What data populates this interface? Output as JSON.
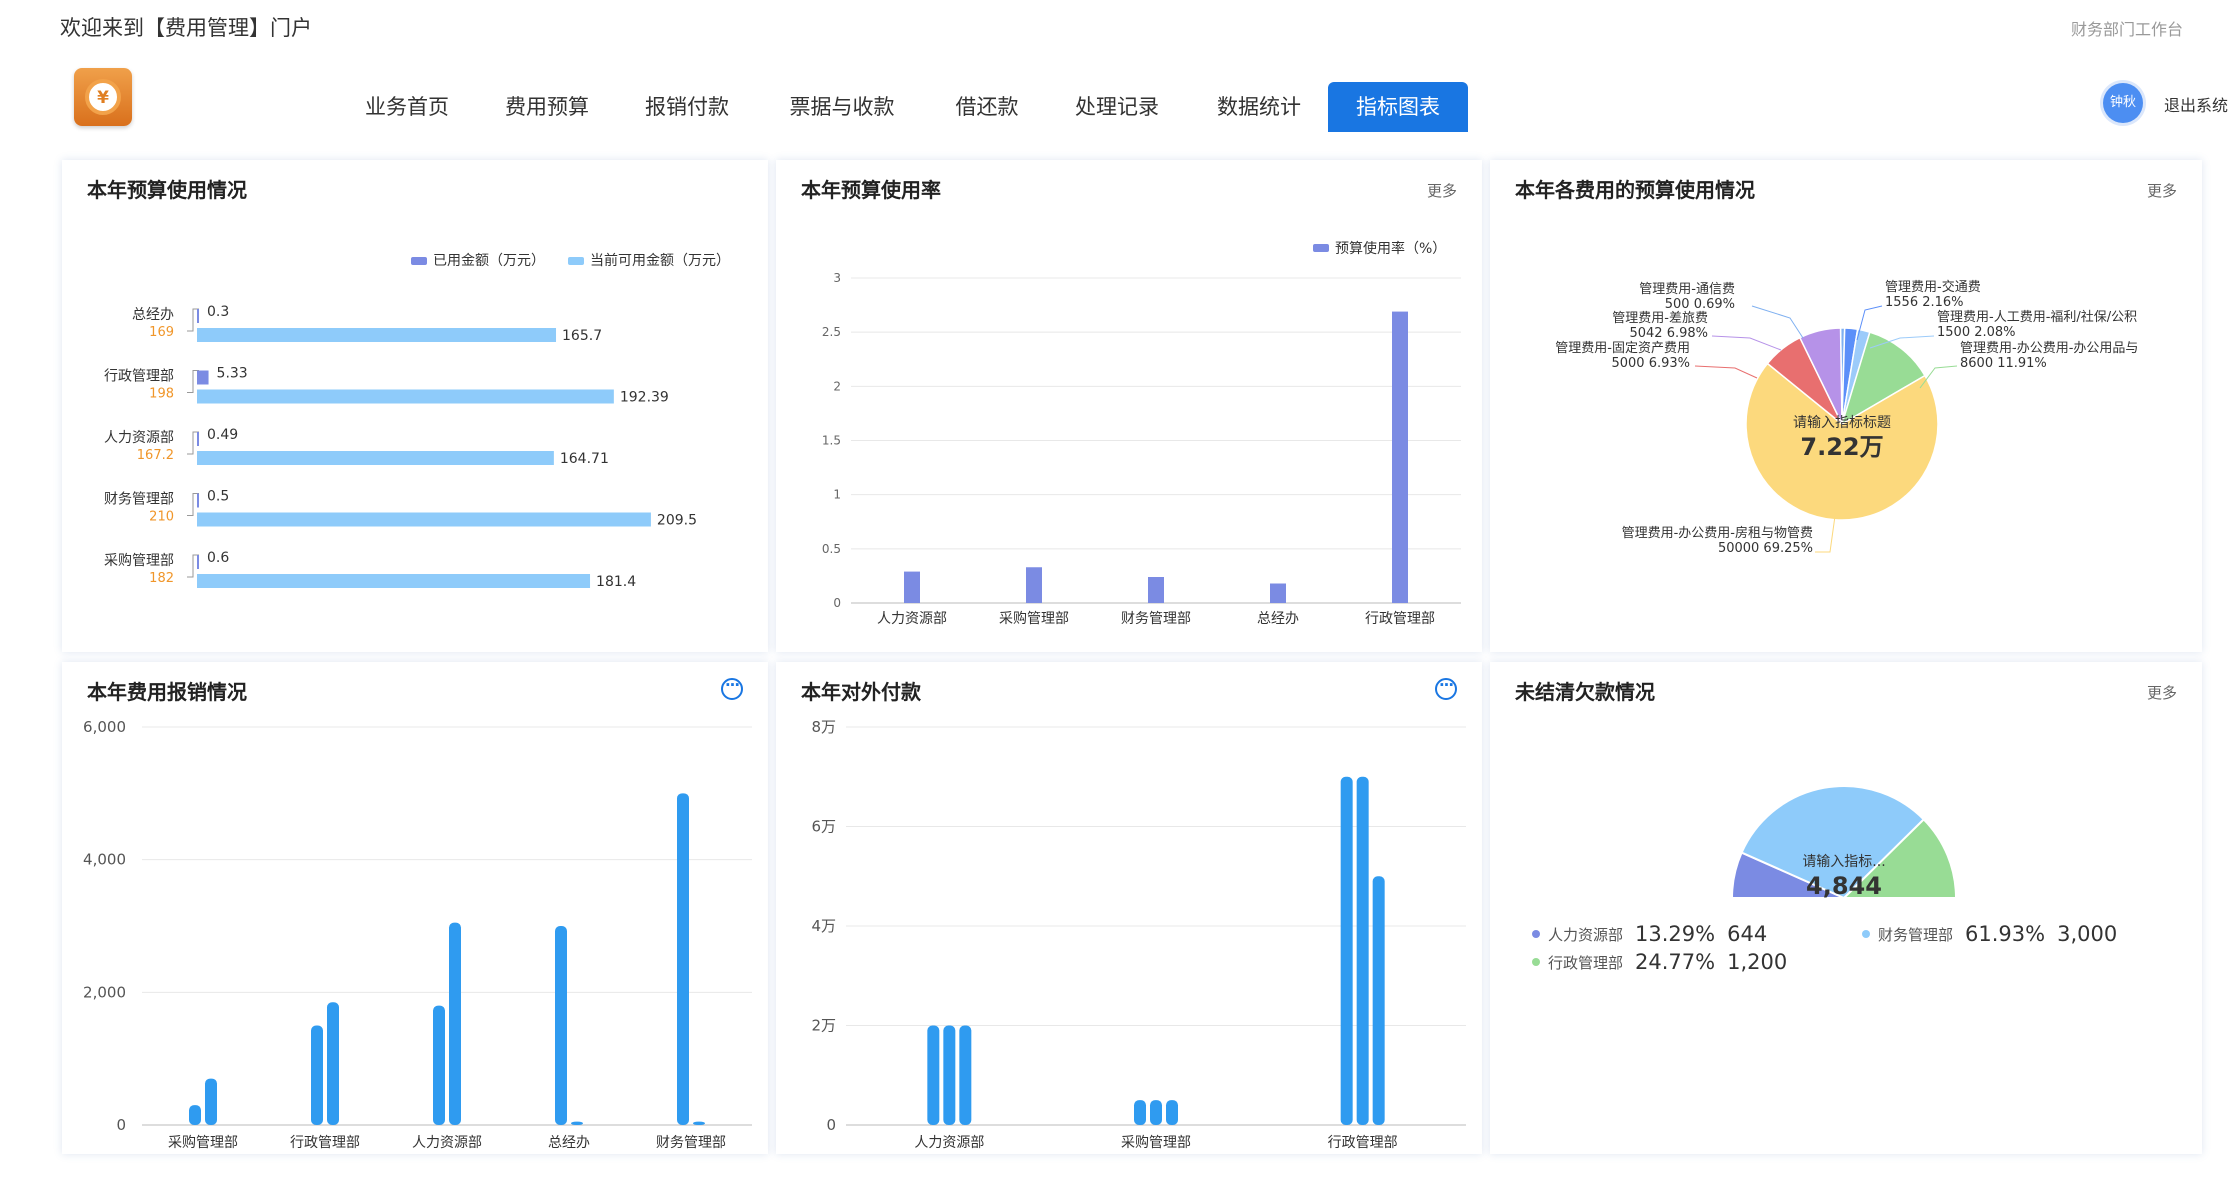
{
  "header": {
    "welcome": "欢迎来到【费用管理】门户",
    "workbench": "财务部门工作台",
    "logo_icon": "yen-coin-icon",
    "avatar": "钟秋",
    "logout": "退出系统"
  },
  "nav": [
    {
      "label": "业务首页",
      "active": false
    },
    {
      "label": "费用预算",
      "active": false
    },
    {
      "label": "报销付款",
      "active": false
    },
    {
      "label": "票据与收款",
      "active": false
    },
    {
      "label": "借还款",
      "active": false
    },
    {
      "label": "处理记录",
      "active": false
    },
    {
      "label": "数据统计",
      "active": false
    },
    {
      "label": "指标图表",
      "active": true
    }
  ],
  "cards": {
    "budget_usage": {
      "title": "本年预算使用情况"
    },
    "budget_rate": {
      "title": "本年预算使用率",
      "more": "更多"
    },
    "expense_pie": {
      "title": "本年各费用的预算使用情况",
      "more": "更多"
    },
    "reimburse": {
      "title": "本年费用报销情况"
    },
    "payment": {
      "title": "本年对外付款"
    },
    "debt": {
      "title": "未结清欠款情况",
      "more": "更多"
    }
  },
  "chart_data": [
    {
      "type": "bar",
      "id": "budget_usage",
      "orientation": "horizontal",
      "categories": [
        "总经办",
        "行政管理部",
        "人力资源部",
        "财务管理部",
        "采购管理部"
      ],
      "category_totals": [
        "169",
        "198",
        "167.2",
        "210",
        "182"
      ],
      "series": [
        {
          "name": "已用金额（万元）",
          "values": [
            0.3,
            5.33,
            0.49,
            0.5,
            0.6
          ],
          "labels": [
            "0.3",
            "5.33",
            "0.49",
            "0.5",
            "0.6"
          ]
        },
        {
          "name": "当前可用金额（万元）",
          "values": [
            165.7,
            192.39,
            164.71,
            209.5,
            181.4
          ],
          "labels": [
            "165.7",
            "192.39",
            "164.71",
            "209.5",
            "181.4"
          ]
        }
      ],
      "colors": {
        "used": "#7b8be3",
        "available": "#8ecbfa",
        "total": "#f0962a"
      },
      "xlim": [
        0,
        210
      ],
      "legend": "top-right"
    },
    {
      "type": "bar",
      "id": "budget_rate",
      "categories": [
        "人力资源部",
        "采购管理部",
        "财务管理部",
        "总经办",
        "行政管理部"
      ],
      "series": [
        {
          "name": "预算使用率（%）",
          "values": [
            0.29,
            0.33,
            0.24,
            0.18,
            2.69
          ]
        }
      ],
      "ylim": [
        0,
        3
      ],
      "yticks": [
        "0",
        "0.5",
        "1",
        "1.5",
        "2",
        "2.5",
        "3"
      ],
      "grid": true,
      "legend": "top-right",
      "color": "#7b8be3"
    },
    {
      "type": "pie",
      "id": "expense_pie",
      "center_label": "请输入指标标题",
      "center_value": "7.22万",
      "slices": [
        {
          "name": "管理费用-办公费用-房租与物管费",
          "value": 50000,
          "pct": "69.25%",
          "color": "#fcd97d"
        },
        {
          "name": "管理费用-固定资产费用",
          "value": 5000,
          "pct": "6.93%",
          "color": "#e86f6f"
        },
        {
          "name": "管理费用-差旅费",
          "value": 5042,
          "pct": "6.98%",
          "color": "#b692e8"
        },
        {
          "name": "管理费用-通信费",
          "value": 500,
          "pct": "0.69%",
          "color": "#7fb0f0"
        },
        {
          "name": "管理费用-交通费",
          "value": 1556,
          "pct": "2.16%",
          "color": "#5b8ff9"
        },
        {
          "name": "管理费用-人工费用-福利/社保/公积",
          "value": 1500,
          "pct": "2.08%",
          "color": "#9ccbfa"
        },
        {
          "name": "管理费用-办公费用-办公用品与",
          "value": 8600,
          "pct": "11.91%",
          "color": "#98dc95"
        }
      ]
    },
    {
      "type": "bar",
      "id": "reimburse",
      "categories": [
        "采购管理部",
        "行政管理部",
        "人力资源部",
        "总经办",
        "财务管理部"
      ],
      "series": [
        {
          "values": [
            300,
            1500,
            1800,
            3000,
            5000
          ]
        },
        {
          "values": [
            700,
            1850,
            3050,
            50,
            50
          ]
        }
      ],
      "ylim": [
        0,
        6000
      ],
      "yticks": [
        "0",
        "2,000",
        "4,000",
        "6,000"
      ],
      "grid": true,
      "color": "#2f9bf0"
    },
    {
      "type": "bar",
      "id": "payment",
      "categories": [
        "人力资源部",
        "采购管理部",
        "行政管理部"
      ],
      "series": [
        {
          "values": [
            20000,
            5000,
            70000
          ]
        },
        {
          "values": [
            20000,
            5000,
            70000
          ]
        },
        {
          "values": [
            20000,
            5000,
            50000
          ]
        }
      ],
      "ylim": [
        0,
        80000
      ],
      "yticks": [
        "0",
        "2万",
        "4万",
        "6万",
        "8万"
      ],
      "grid": true,
      "color": "#2f9bf0"
    },
    {
      "type": "pie",
      "id": "debt",
      "style": "half-donut",
      "center_label": "请输入指标...",
      "center_value": "4,844",
      "slices": [
        {
          "name": "人力资源部",
          "value": 644,
          "pct": "13.29%",
          "value_label": "644",
          "color": "#7b8be3"
        },
        {
          "name": "行政管理部",
          "value": 1200,
          "pct": "24.77%",
          "value_label": "1,200",
          "color": "#98dc95"
        },
        {
          "name": "财务管理部",
          "value": 3000,
          "pct": "61.93%",
          "value_label": "3,000",
          "color": "#8ecbfa"
        }
      ]
    }
  ]
}
